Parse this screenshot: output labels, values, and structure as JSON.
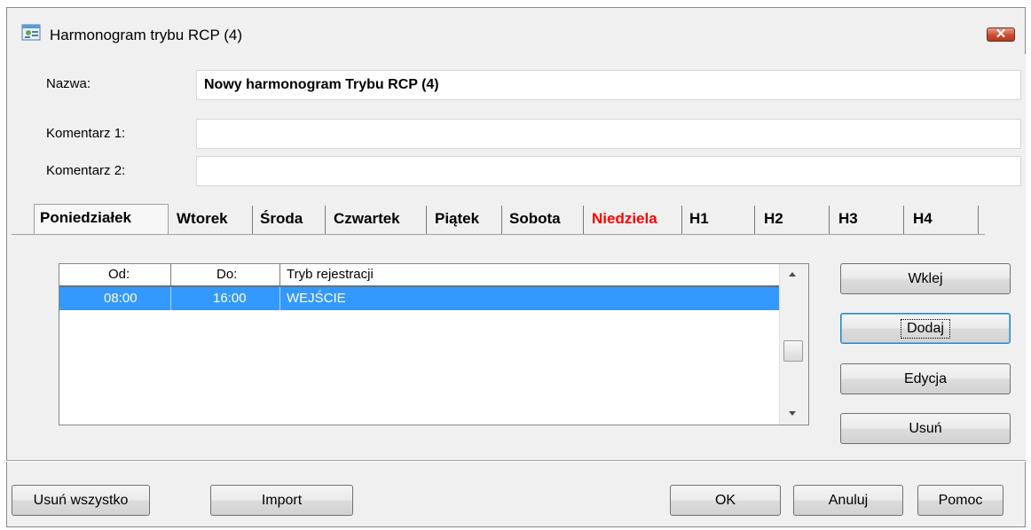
{
  "window": {
    "title": "Harmonogram trybu RCP (4)",
    "close_symbol": "✕"
  },
  "form": {
    "name_label": "Nazwa:",
    "name_value": "Nowy harmonogram Trybu RCP (4)",
    "comment1_label": "Komentarz 1:",
    "comment1_value": "",
    "comment2_label": "Komentarz 2:",
    "comment2_value": ""
  },
  "tabs": [
    {
      "label": "Poniedziałek"
    },
    {
      "label": "Wtorek"
    },
    {
      "label": "Środa"
    },
    {
      "label": "Czwartek"
    },
    {
      "label": "Piątek"
    },
    {
      "label": "Sobota"
    },
    {
      "label": "Niedziela"
    },
    {
      "label": "H1"
    },
    {
      "label": "H2"
    },
    {
      "label": "H3"
    },
    {
      "label": "H4"
    }
  ],
  "grid": {
    "columns": [
      "Od:",
      "Do:",
      "Tryb rejestracji"
    ],
    "rows": [
      {
        "od": "08:00",
        "do": "16:00",
        "tryb": "WEJŚCIE"
      }
    ]
  },
  "side_buttons": {
    "wklej": "Wklej",
    "dodaj": "Dodaj",
    "edycja": "Edycja",
    "usun": "Usuń"
  },
  "bottom_buttons": {
    "usun_wszystko": "Usuń wszystko",
    "import": "Import",
    "ok": "OK",
    "anuluj": "Anuluj",
    "pomoc": "Pomoc"
  },
  "colors": {
    "selection": "#3399ff",
    "sunday_tab": "#ff0000",
    "close_button": "#c94b30"
  },
  "icons": {
    "app": "schedule-app-icon",
    "scroll_up": "triangle-up",
    "scroll_down": "triangle-down"
  }
}
